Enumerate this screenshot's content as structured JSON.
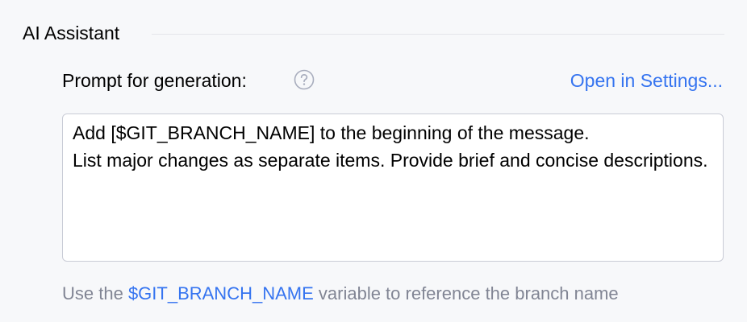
{
  "section": {
    "title": "AI Assistant"
  },
  "prompt": {
    "label": "Prompt for generation:",
    "help_icon": "question-circle-icon",
    "open_settings_label": "Open in Settings...",
    "text": "Add [$GIT_BRANCH_NAME] to the beginning of the message.\nList major changes as separate items. Provide brief and concise descriptions."
  },
  "hint": {
    "prefix": "Use the ",
    "variable": "$GIT_BRANCH_NAME",
    "suffix": " variable to reference the branch name"
  },
  "colors": {
    "link": "#3574f0",
    "hint_text": "#818594",
    "background": "#f7f8fa",
    "input_border": "#c9ccd6"
  }
}
